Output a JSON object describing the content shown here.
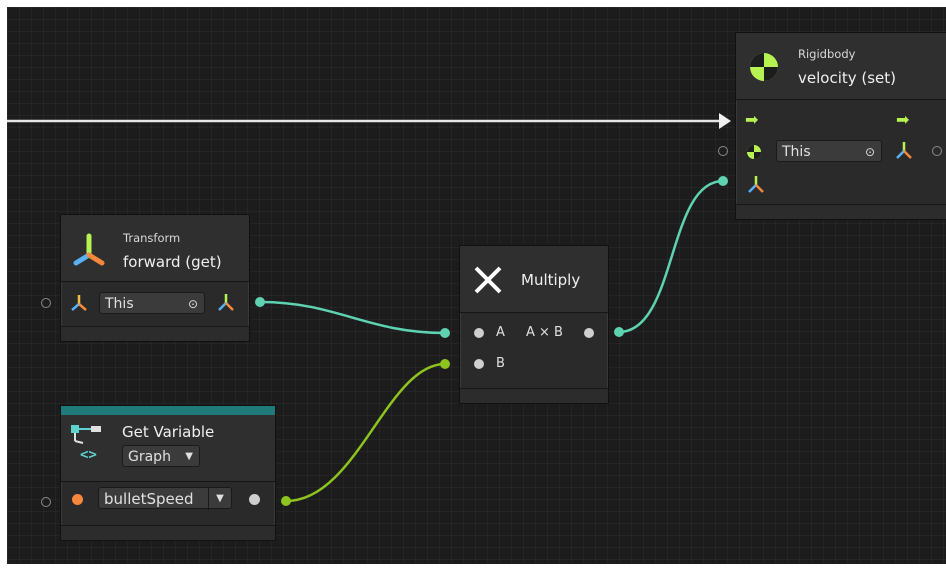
{
  "colors": {
    "canvas": "#1c1c1c",
    "node_body": "#2a2a2a",
    "wire_flow": "#e6e6e6",
    "wire_vector": "#5fd2b0",
    "wire_float": "#8ec41e",
    "port_float": "#f5883a",
    "teal_bar": "#1f7a7a",
    "green_accent": "#b6f252"
  },
  "nodes": {
    "rigidbody": {
      "category": "Rigidbody",
      "title": "velocity (set)",
      "target_value": "This",
      "icon": "rigidbody-icon"
    },
    "transform": {
      "category": "Transform",
      "title": "forward (get)",
      "target_value": "This",
      "icon": "transform-axes-icon"
    },
    "multiply": {
      "title": "Multiply",
      "input_a": "A",
      "input_b": "B",
      "output": "A × B",
      "icon": "multiply-x-icon"
    },
    "get_variable": {
      "title": "Get Variable",
      "scope": "Graph",
      "variable_name": "bulletSpeed",
      "icon": "variable-icon"
    }
  }
}
